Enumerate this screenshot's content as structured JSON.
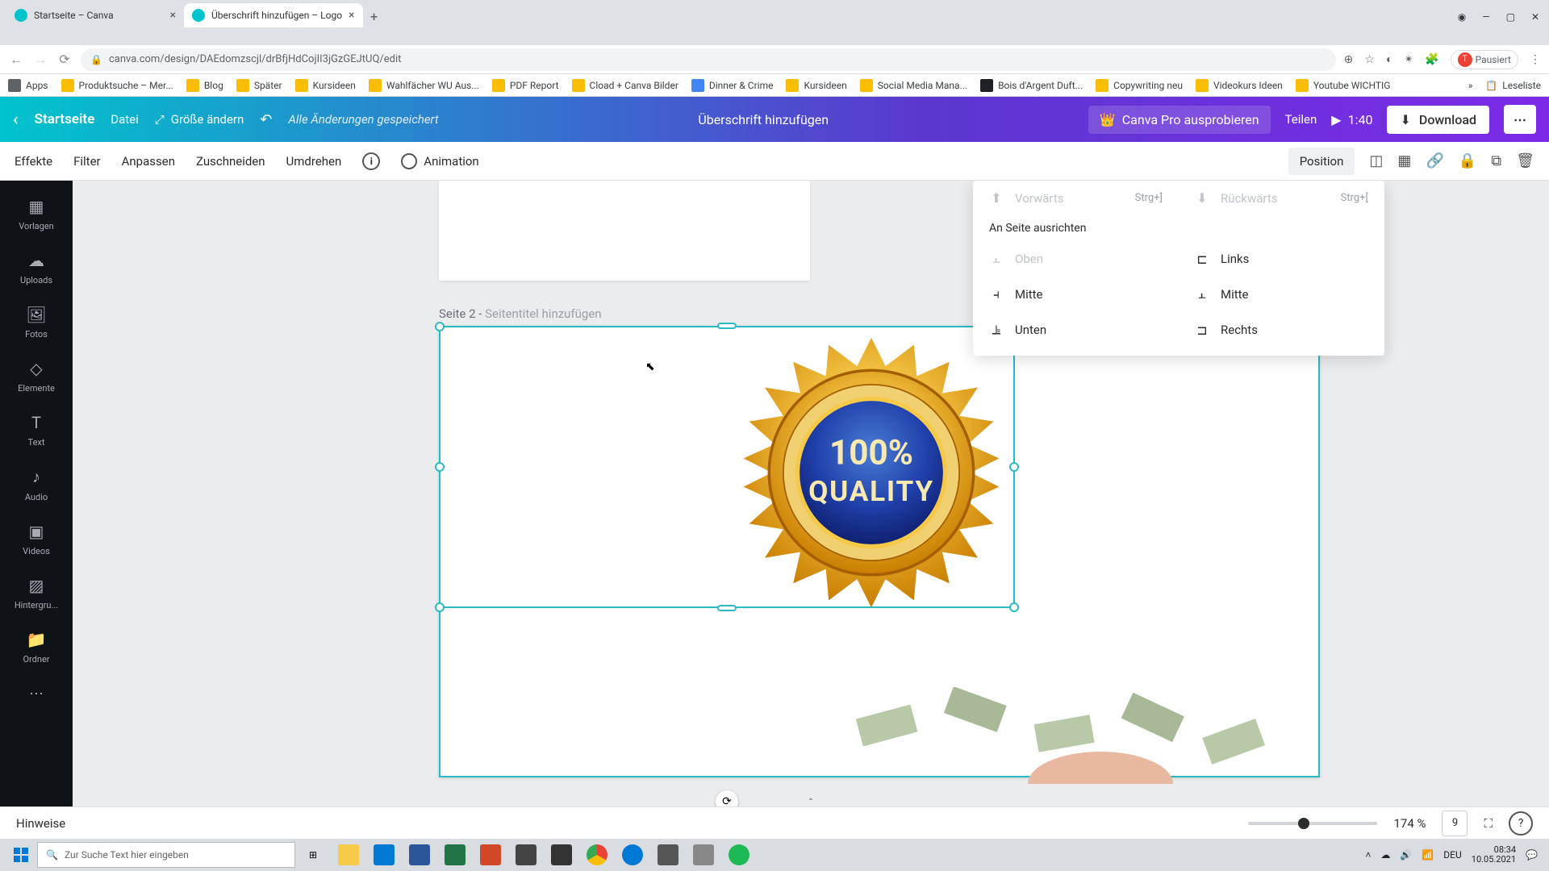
{
  "browser": {
    "tabs": [
      {
        "title": "Startseite – Canva",
        "active": false
      },
      {
        "title": "Überschrift hinzufügen – Logo",
        "active": true
      }
    ],
    "url": "canva.com/design/DAEdomzscjl/drBfjHdCojII3jGzGEJtUQ/edit",
    "profile_status": "Pausiert",
    "bookmarks": [
      "Apps",
      "Produktsuche – Mer...",
      "Blog",
      "Später",
      "Kursideen",
      "Wahlfächer WU Aus...",
      "PDF Report",
      "Cload + Canva Bilder",
      "Dinner & Crime",
      "Kursideen",
      "Social Media Mana...",
      "Bois d'Argent Duft...",
      "Copywriting neu",
      "Videokurs Ideen",
      "Youtube WICHTIG",
      "Leseliste"
    ]
  },
  "header": {
    "back": "‹",
    "home": "Startseite",
    "file": "Datei",
    "resize": "Größe ändern",
    "saved": "Alle Änderungen gespeichert",
    "title": "Überschrift hinzufügen",
    "try_pro": "Canva Pro ausprobieren",
    "share": "Teilen",
    "playtime": "1:40",
    "download": "Download"
  },
  "toolbar": {
    "effects": "Effekte",
    "filter": "Filter",
    "adjust": "Anpassen",
    "crop": "Zuschneiden",
    "flip": "Umdrehen",
    "animation": "Animation",
    "position": "Position"
  },
  "siderail": {
    "templates": "Vorlagen",
    "uploads": "Uploads",
    "photos": "Fotos",
    "elements": "Elemente",
    "text": "Text",
    "audio": "Audio",
    "videos": "Videos",
    "backgrounds": "Hintergru...",
    "folders": "Ordner"
  },
  "page": {
    "label_prefix": "Seite 2 - ",
    "label_placeholder": "Seitentitel hinzufügen",
    "badge_top": "100%",
    "badge_bottom": "QUALITY"
  },
  "popup": {
    "forward": "Vorwärts",
    "forward_sc": "Strg+]",
    "backward": "Rückwärts",
    "backward_sc": "Strg+[",
    "align_heading": "An Seite ausrichten",
    "top": "Oben",
    "links": "Links",
    "mitte_v": "Mitte",
    "mitte_h": "Mitte",
    "unten": "Unten",
    "rechts": "Rechts"
  },
  "footer": {
    "hints": "Hinweise",
    "zoom": "174 %",
    "pages": "9"
  },
  "taskbar": {
    "search_placeholder": "Zur Suche Text hier eingeben",
    "lang": "DEU",
    "time": "08:34",
    "date": "10.05.2021"
  }
}
